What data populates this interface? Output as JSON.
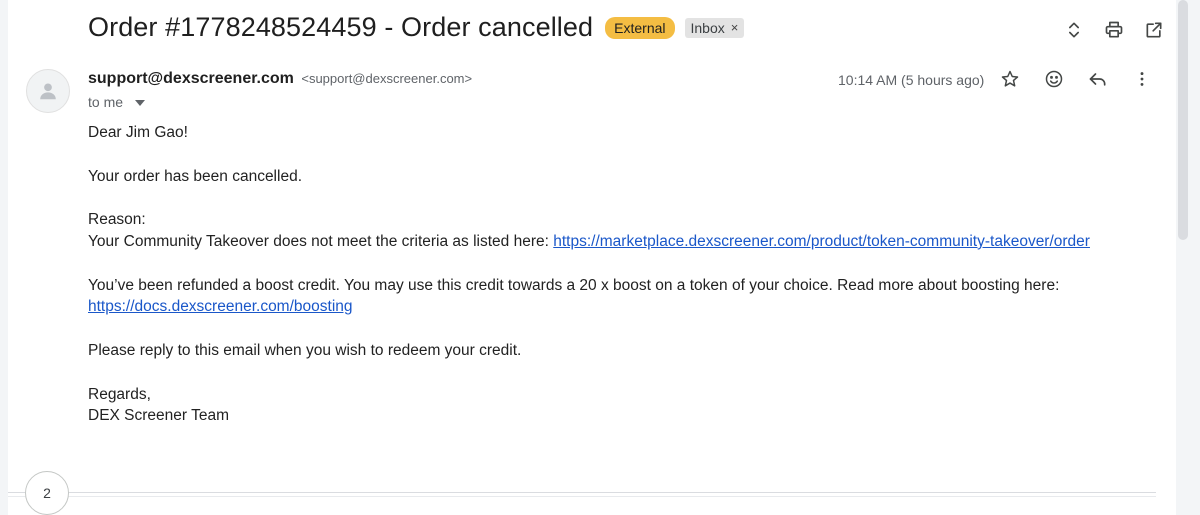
{
  "email": {
    "subject": "Order #1778248524459 - Order cancelled",
    "labels": {
      "external": "External",
      "inbox": "Inbox",
      "inbox_remove": "×"
    },
    "sender": {
      "name": "support@dexscreener.com",
      "email": "<support@dexscreener.com>"
    },
    "recipient": "to me",
    "time": "10:14 AM (5 hours ago)",
    "body": {
      "greeting": "Dear Jim Gao!",
      "line1": "Your order has been cancelled.",
      "reason_label": "Reason:",
      "reason_text": "Your Community Takeover does not meet the criteria as listed here: ",
      "reason_link": "https://marketplace.dexscreener.com/product/token-community-takeover/order",
      "refund_text": "You’ve been refunded a boost credit. You may use this credit towards a 20 x boost on a token of your choice. Read more about boosting here:",
      "refund_link": "https://docs.dexscreener.com/boosting",
      "reply_text": "Please reply to this email when you wish to redeem your credit.",
      "signoff": "Regards,",
      "signature": "DEX Screener Team"
    },
    "thread_count": "2"
  },
  "colors": {
    "external_badge": "#f4bd43",
    "inbox_badge": "#e3e3e3",
    "link": "#1a57c9"
  },
  "icons": {
    "top": [
      "expand-collapse-icon",
      "print-icon",
      "open-in-new-window-icon"
    ],
    "message": [
      "star-icon",
      "emoji-reaction-icon",
      "reply-icon",
      "more-vert-icon"
    ],
    "avatar": "person-icon"
  }
}
